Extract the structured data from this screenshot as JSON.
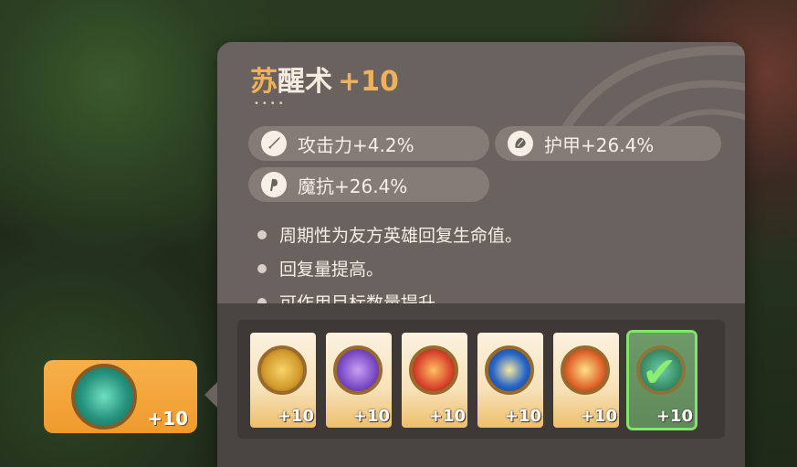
{
  "skill": {
    "name_first": "苏",
    "name_rest": "醒术",
    "level": "+10",
    "dots": "••••"
  },
  "stats": [
    {
      "icon": "sword-icon",
      "label": "攻击力+4.2%"
    },
    {
      "icon": "armor-icon",
      "label": "护甲+26.4%"
    },
    {
      "icon": "magic-resist-icon",
      "label": "魔抗+26.4%"
    }
  ],
  "effects": [
    "周期性为友方英雄回复生命值。",
    "回复量提高。",
    "可作用目标数量提升。"
  ],
  "options": [
    {
      "name": "yellow-shield-emblem",
      "level": "+10",
      "color": "#d49a2c"
    },
    {
      "name": "purple-star-emblem",
      "level": "+10",
      "color": "#7a4ac6"
    },
    {
      "name": "red-flame-emblem",
      "level": "+10",
      "color": "#d9442c"
    },
    {
      "name": "blue-vortex-emblem",
      "level": "+10",
      "color": "#2a68c8"
    },
    {
      "name": "orange-comet-emblem",
      "level": "+10",
      "color": "#e0642a"
    },
    {
      "name": "green-heal-emblem",
      "level": "+10",
      "color": "#2d8e6a",
      "selected": true
    }
  ],
  "equipped": {
    "name": "green-heal-emblem",
    "level": "+10"
  },
  "colors": {
    "accent": "#f0b15a",
    "panel": "#6a625f",
    "selected": "#83e36a"
  }
}
